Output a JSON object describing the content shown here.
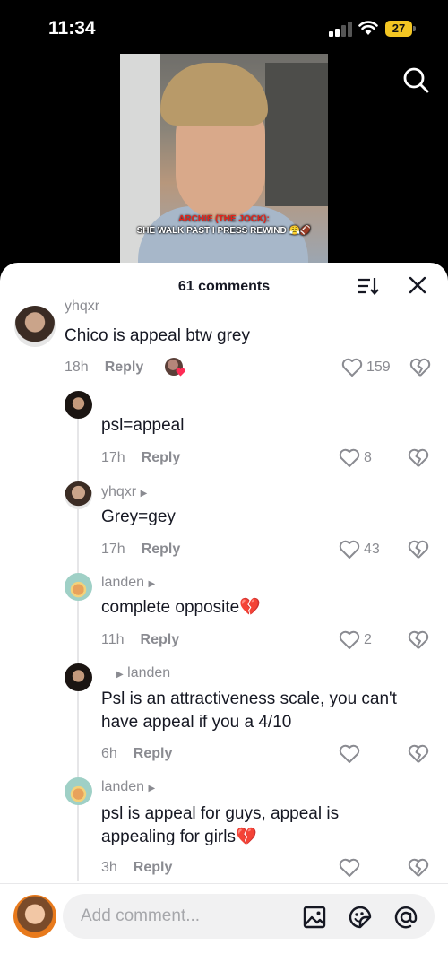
{
  "status": {
    "time": "11:34",
    "battery": "27"
  },
  "video": {
    "caption_line1": "ARCHIE (THE JOCK):",
    "caption_line2": "SHE WALK PAST I PRESS REWIND 😤🏈"
  },
  "sheet": {
    "title": "61 comments"
  },
  "comments": [
    {
      "user": "yhqxr",
      "text": "Chico is appeal btw grey",
      "time": "18h",
      "reply": "Reply",
      "likes": "159"
    },
    {
      "user": "",
      "text": "psl=appeal",
      "time": "17h",
      "reply": "Reply",
      "likes": "8"
    },
    {
      "user": "yhqxr",
      "text": "Grey=gey",
      "time": "17h",
      "reply": "Reply",
      "likes": "43"
    },
    {
      "user": "landen",
      "text": "complete opposite💔",
      "time": "11h",
      "reply": "Reply",
      "likes": "2"
    },
    {
      "user": "landen",
      "text": "Psl is an attractiveness scale, you can't have appeal if you a 4/10",
      "time": "6h",
      "reply": "Reply",
      "likes": ""
    },
    {
      "user": "landen",
      "text": "psl is appeal for guys, appeal is appealing for girls💔",
      "time": "3h",
      "reply": "Reply",
      "likes": ""
    }
  ],
  "input": {
    "placeholder": "Add comment..."
  },
  "icons": {
    "search": "search-icon",
    "sort": "sort-icon",
    "close": "close-icon",
    "like": "heart-outline-icon",
    "dislike": "broken-heart-icon",
    "image": "image-icon",
    "emoji": "emoji-icon",
    "mention": "at-icon"
  }
}
